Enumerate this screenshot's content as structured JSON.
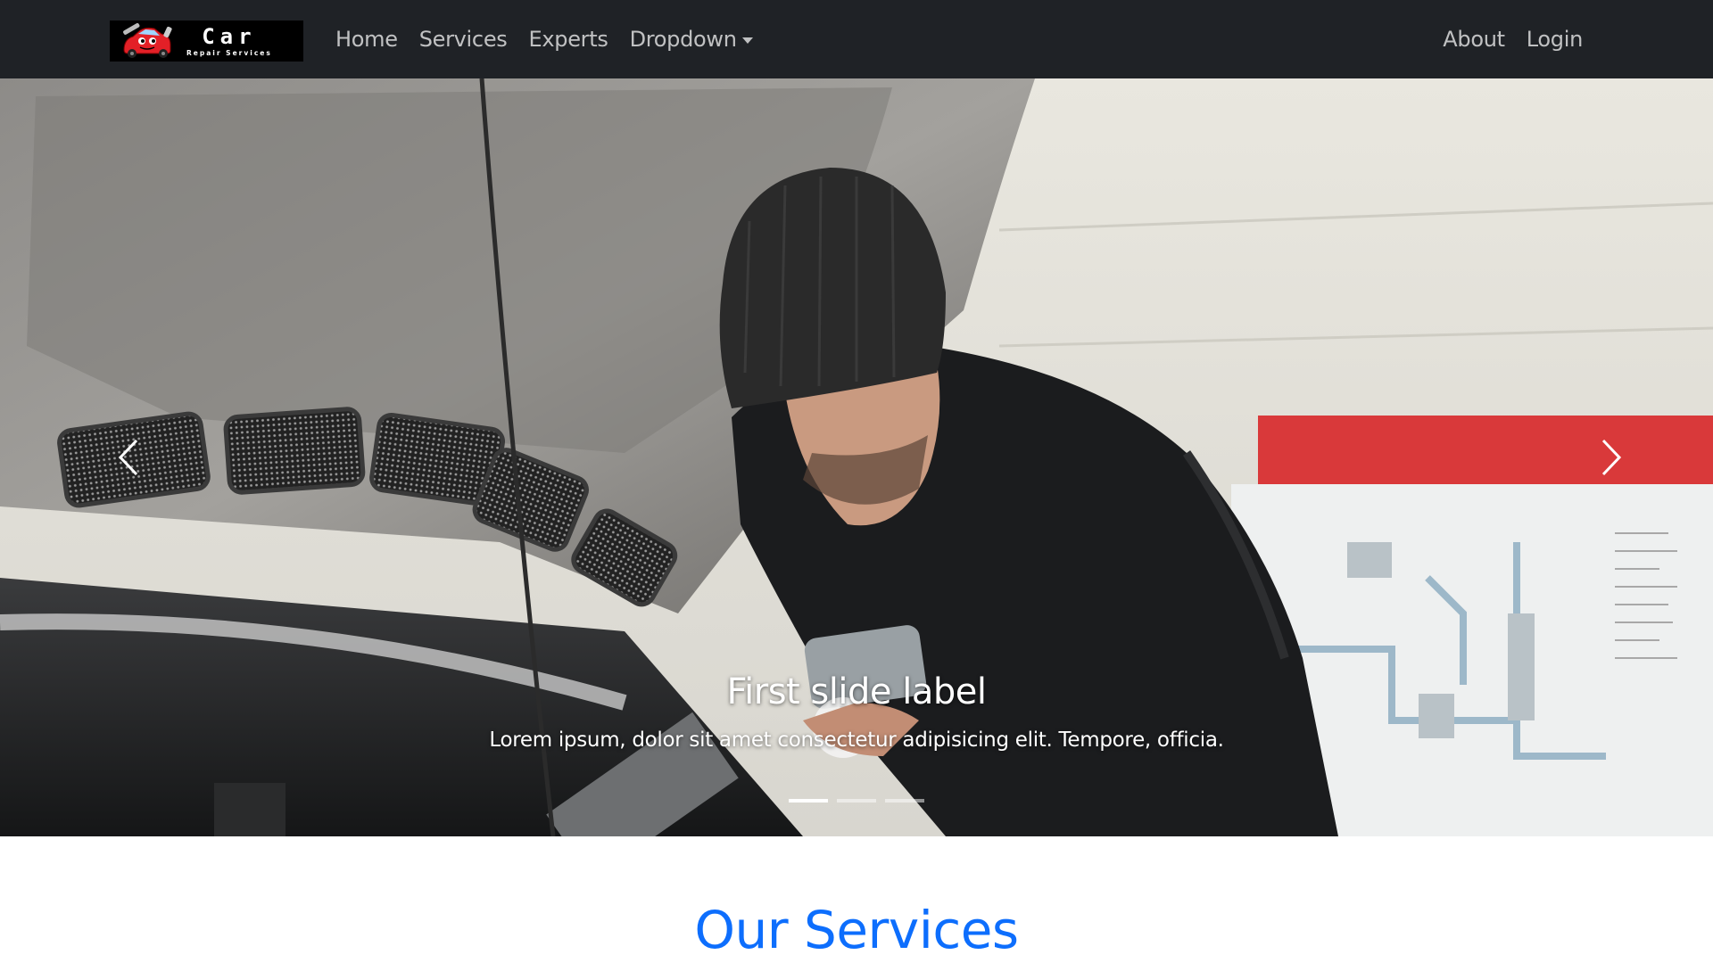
{
  "brand": {
    "title": "Car",
    "subtitle": "Repair Services"
  },
  "nav": {
    "left": [
      "Home",
      "Services",
      "Experts",
      "Dropdown"
    ],
    "right": [
      "About",
      "Login"
    ]
  },
  "carousel": {
    "caption_title": "First slide label",
    "caption_text": "Lorem ipsum, dolor sit amet consectetur adipisicing elit. Tempore, officia.",
    "indicator_count": 3,
    "active_index": 0
  },
  "section": {
    "heading": "Our Services"
  },
  "colors": {
    "navbar": "#1f2226",
    "accent": "#0d6efd"
  },
  "icons": {
    "prev": "chevron-left-icon",
    "next": "chevron-right-icon",
    "dropdown": "caret-down-icon"
  }
}
